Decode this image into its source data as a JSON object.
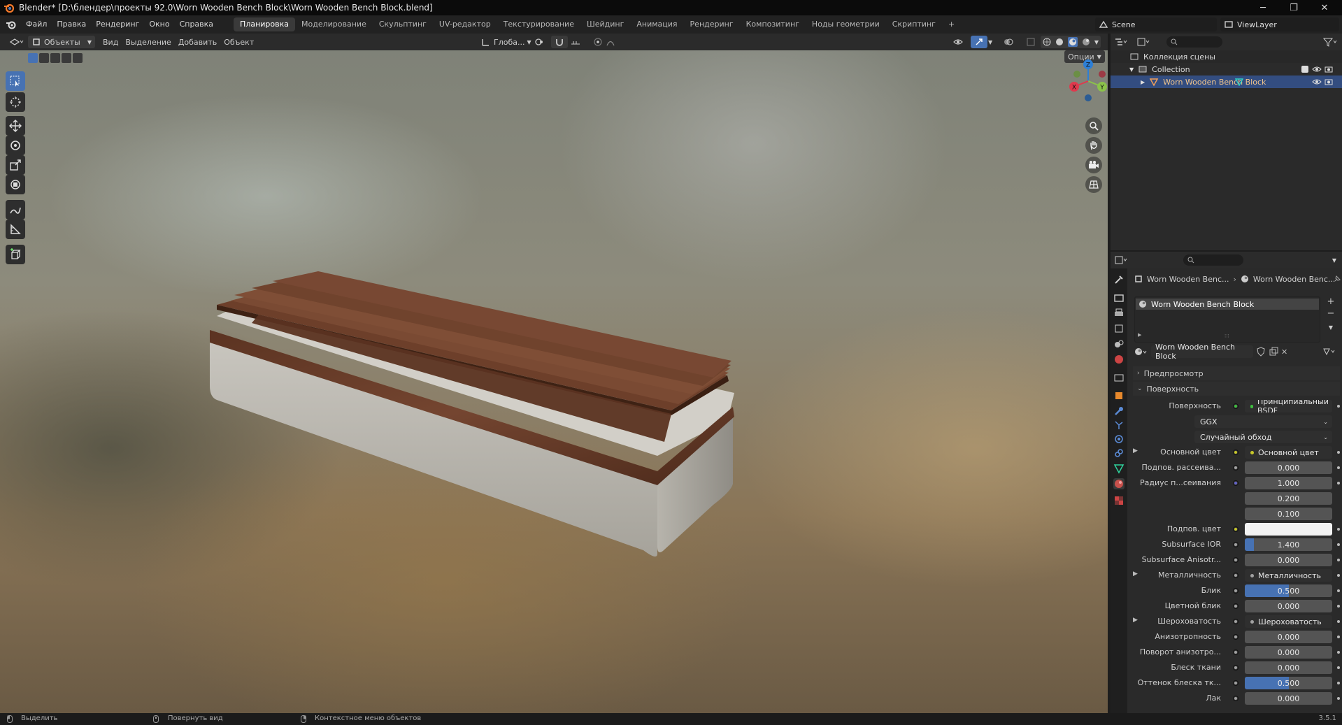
{
  "window": {
    "title": "Blender* [D:\\блендер\\проекты 92.0\\Worn Wooden Bench Block\\Worn Wooden Bench Block.blend]",
    "minimize": "─",
    "maximize": "❐",
    "close": "✕"
  },
  "menu": [
    "Файл",
    "Правка",
    "Рендеринг",
    "Окно",
    "Справка"
  ],
  "workspaces": [
    "Планировка",
    "Моделирование",
    "Скульптинг",
    "UV-редактор",
    "Текстурирование",
    "Шейдинг",
    "Анимация",
    "Рендеринг",
    "Композитинг",
    "Ноды геометрии",
    "Скриптинг"
  ],
  "active_workspace": "Планировка",
  "add_workspace": "+",
  "scene": {
    "label": "Scene",
    "viewlayer": "ViewLayer"
  },
  "viewport_header": {
    "mode": "Объекты",
    "view": "Вид",
    "select": "Выделение",
    "add": "Добавить",
    "object": "Объект",
    "orientation": "Глоба...",
    "options": "Опции"
  },
  "gizmo": {
    "x": "X",
    "y": "Y",
    "z": "Z"
  },
  "outliner": {
    "scene_collection": "Коллекция сцены",
    "collection": "Collection",
    "object": "Worn Wooden Bench Block"
  },
  "properties": {
    "breadcrumb_object": "Worn Wooden Benc...",
    "breadcrumb_material": "Worn Wooden Benc...",
    "slot": "Worn Wooden Bench Block",
    "material_name": "Worn Wooden Bench Block",
    "preview": "Предпросмотр",
    "surface_panel": "Поверхность",
    "rows": [
      {
        "label": "Поверхность",
        "value": "Принципиальный BSDF",
        "kind": "link",
        "sock": "#3fbf3f"
      },
      {
        "label": "",
        "value": "GGX",
        "kind": "enum"
      },
      {
        "label": "",
        "value": "Случайный обход",
        "kind": "enum"
      },
      {
        "label": "Основной цвет",
        "value": "Основной цвет",
        "kind": "link",
        "sock": "#c7c729",
        "expand": true
      },
      {
        "label": "Подпов. рассеива...",
        "value": "0.000",
        "kind": "num",
        "fill": 0,
        "sock": "#a1a1a1"
      },
      {
        "label": "Радиус п...сеивания",
        "value": "1.000",
        "kind": "vec",
        "sock": "#6363c7"
      },
      {
        "label": "",
        "value": "0.200",
        "kind": "vec"
      },
      {
        "label": "",
        "value": "0.100",
        "kind": "vec"
      },
      {
        "label": "Подпов. цвет",
        "value": "",
        "kind": "color",
        "sock": "#c7c729"
      },
      {
        "label": "Subsurface IOR",
        "value": "1.400",
        "kind": "num",
        "fill": 0.1,
        "sock": "#a1a1a1"
      },
      {
        "label": "Subsurface Anisotr...",
        "value": "0.000",
        "kind": "num",
        "fill": 0,
        "sock": "#a1a1a1"
      },
      {
        "label": "Металличность",
        "value": "Металличность",
        "kind": "link",
        "sock": "#a1a1a1",
        "expand": true
      },
      {
        "label": "Блик",
        "value": "0.500",
        "kind": "num",
        "fill": 0.5,
        "sock": "#a1a1a1"
      },
      {
        "label": "Цветной блик",
        "value": "0.000",
        "kind": "num",
        "fill": 0,
        "sock": "#a1a1a1"
      },
      {
        "label": "Шероховатость",
        "value": "Шероховатость",
        "kind": "link",
        "sock": "#a1a1a1",
        "expand": true
      },
      {
        "label": "Анизотропность",
        "value": "0.000",
        "kind": "num",
        "fill": 0,
        "sock": "#a1a1a1"
      },
      {
        "label": "Поворот анизотро...",
        "value": "0.000",
        "kind": "num",
        "fill": 0,
        "sock": "#a1a1a1"
      },
      {
        "label": "Блеск ткани",
        "value": "0.000",
        "kind": "num",
        "fill": 0,
        "sock": "#a1a1a1"
      },
      {
        "label": "Оттенок блеска тк...",
        "value": "0.500",
        "kind": "num",
        "fill": 0.5,
        "sock": "#a1a1a1"
      },
      {
        "label": "Лак",
        "value": "0.000",
        "kind": "num",
        "fill": 0,
        "sock": "#a1a1a1"
      }
    ]
  },
  "status": {
    "select": "Выделить",
    "rotate": "Повернуть вид",
    "context": "Контекстное меню объектов",
    "version": "3.5.1"
  }
}
